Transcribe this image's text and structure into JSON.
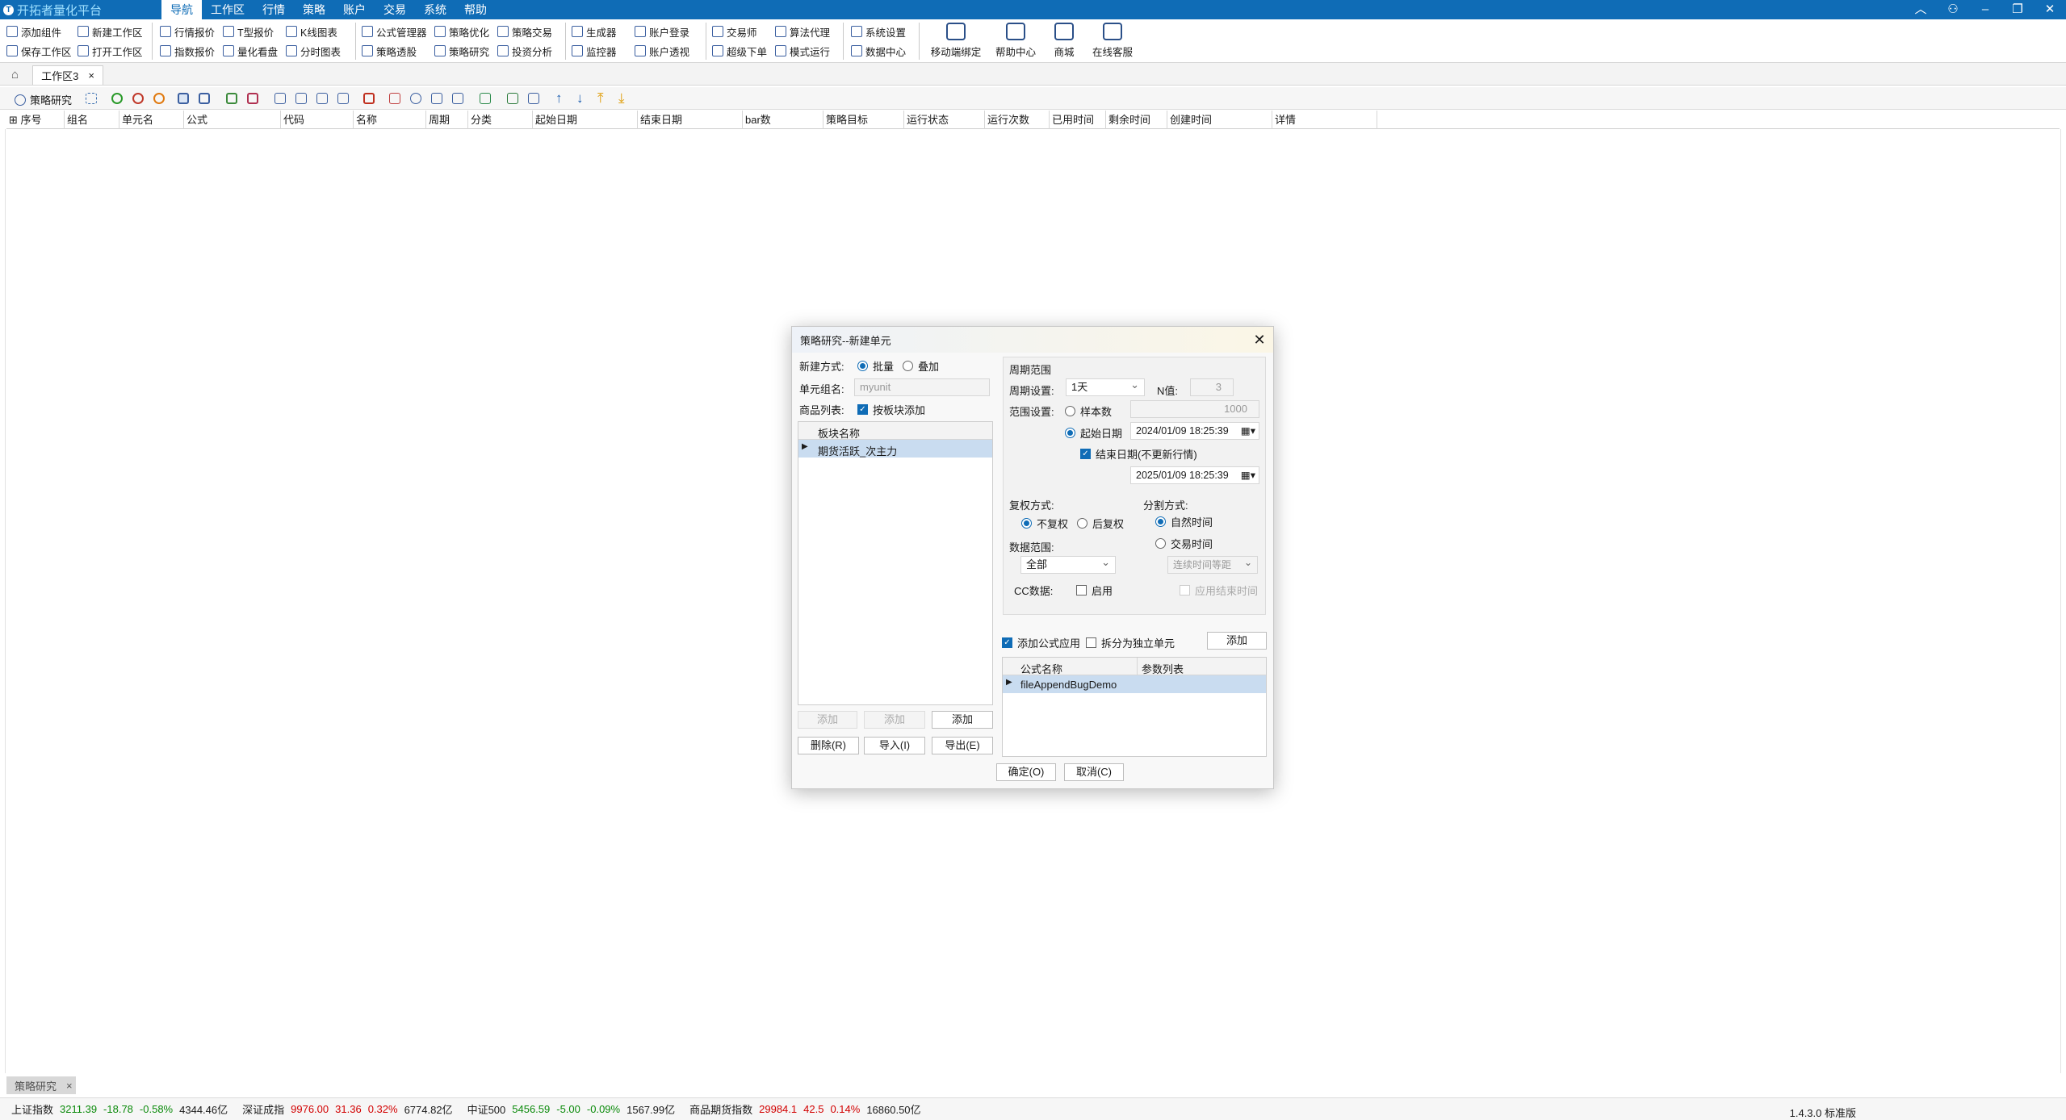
{
  "app": {
    "title": "开拓者量化平台",
    "menu": [
      "导航",
      "工作区",
      "行情",
      "策略",
      "账户",
      "交易",
      "系统",
      "帮助"
    ],
    "active_menu": "导航"
  },
  "ribbon": {
    "row1": [
      "添加组件",
      "新建工作区",
      "行情报价",
      "T型报价",
      "K线图表",
      "公式管理器",
      "策略优化",
      "策略交易",
      "生成器",
      "账户登录",
      "交易师",
      "算法代理",
      "系统设置"
    ],
    "row2": [
      "保存工作区",
      "打开工作区",
      "指数报价",
      "量化看盘",
      "分时图表",
      "策略透股",
      "策略研究",
      "投资分析",
      "监控器",
      "账户透视",
      "超级下单",
      "模式运行",
      "数据中心"
    ],
    "big": [
      "移动端绑定",
      "帮助中心",
      "商城",
      "在线客服"
    ]
  },
  "workspace": {
    "tab": "工作区3",
    "close": "×"
  },
  "toolbar": {
    "label": "策略研究"
  },
  "columns": [
    "序号",
    "组名",
    "单元名",
    "公式",
    "代码",
    "名称",
    "周期",
    "分类",
    "起始日期",
    "结束日期",
    "bar数",
    "策略目标",
    "运行状态",
    "运行次数",
    "已用时间",
    "剩余时间",
    "创建时间",
    "详情"
  ],
  "bottom_tab": {
    "label": "策略研究",
    "close": "×"
  },
  "status": {
    "items": [
      {
        "name": "上证指数",
        "value": "3211.39",
        "change": "-18.78",
        "pct": "-0.58%",
        "amount": "4344.46亿",
        "dir": "dn"
      },
      {
        "name": "深证成指",
        "value": "9976.00",
        "change": "31.36",
        "pct": "0.32%",
        "amount": "6774.82亿",
        "dir": "up"
      },
      {
        "name": "中证500",
        "value": "5456.59",
        "change": "-5.00",
        "pct": "-0.09%",
        "amount": "1567.99亿",
        "dir": "dn"
      },
      {
        "name": "商品期货指数",
        "value": "29984.1",
        "change": "42.5",
        "pct": "0.14%",
        "amount": "16860.50亿",
        "dir": "up"
      }
    ],
    "version": "1.4.3.0 标准版"
  },
  "dialog": {
    "title": "策略研究--新建单元",
    "close": "✕",
    "create_mode_label": "新建方式:",
    "mode_batch": "批量",
    "mode_stack": "叠加",
    "unit_group_label": "单元组名:",
    "unit_group_value": "myunit",
    "goods_label": "商品列表:",
    "by_block": "按板块添加",
    "block_header": "板块名称",
    "block_row": "期货活跃_次主力",
    "add1": "添加",
    "add2": "添加",
    "add3": "添加",
    "delete": "删除(R)",
    "import": "导入(I)",
    "export": "导出(E)",
    "period_range": "周期范围",
    "period_setting_label": "周期设置:",
    "period_value": "1天",
    "n_label": "N值:",
    "n_value": "3",
    "range_label": "范围设置:",
    "sample_count": "样本数",
    "sample_value": "1000",
    "start_date_label": "起始日期",
    "start_date": "2024/01/09 18:25:39",
    "end_date_label": "结束日期(不更新行情)",
    "end_date": "2025/01/09 18:25:39",
    "adjust_label": "复权方式:",
    "adjust_none": "不复权",
    "adjust_back": "后复权",
    "split_label": "分割方式:",
    "split_natural": "自然时间",
    "split_trade": "交易时间",
    "data_range_label": "数据范围:",
    "data_range_value": "全部",
    "gap_value": "连续时间等距",
    "cc_label": "CC数据:",
    "cc_enable": "启用",
    "use_end_time": "应用结束时间",
    "add_formula": "添加公式应用",
    "split_unit": "拆分为独立单元",
    "formula_add": "添加",
    "formula_col": "公式名称",
    "param_col": "参数列表",
    "formula_row": "fileAppendBugDemo",
    "ok": "确定(O)",
    "cancel": "取消(C)"
  }
}
